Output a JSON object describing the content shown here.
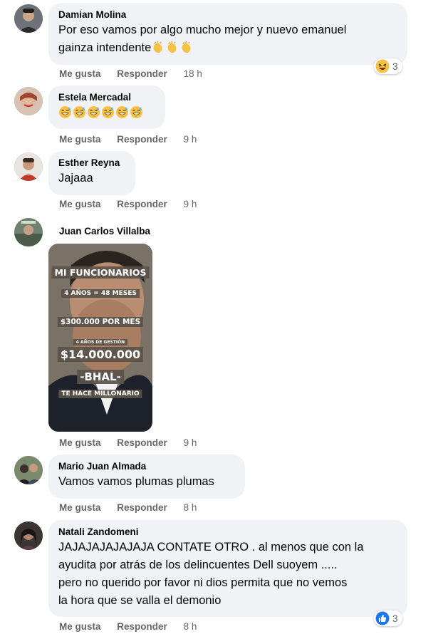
{
  "actions": {
    "like": "Me gusta",
    "reply": "Responder"
  },
  "comments": [
    {
      "author": "Damian Molina",
      "text": "Por eso vamos por algo mucho mejor y nuevo emanuel",
      "text2": "gainza intendente",
      "time": "18 h",
      "reaction": {
        "icon": "laughing-emoji-icon",
        "count": "3"
      }
    },
    {
      "author": "Estela Mercadal",
      "time": "9 h",
      "emoji_count": 6
    },
    {
      "author": "Esther Reyna",
      "text": "Jajaaa",
      "time": "9 h"
    },
    {
      "author": "Juan Carlos Villalba",
      "time": "9 h",
      "image_text": {
        "title": "MI FUNCIONARIOS",
        "line1": "4 AÑOS = 48 MESES",
        "line2": "$300.000 POR MES",
        "line3": "4 AÑOS DE GESTIÓN",
        "amount": "$14.000.000",
        "name": "-BHAL-",
        "tagline": "TE HACE MILLONARIO"
      }
    },
    {
      "author": "Mario Juan Almada",
      "text": "Vamos vamos plumas plumas",
      "time": "8 h"
    },
    {
      "author": "Natali Zandomeni",
      "lines": [
        "JAJAJAJAJAJAJA CONTATE OTRO . al menos que con la",
        "ayudita por atrás de los delincuentes Dell suoyem .....",
        "pero no querido por favor ni dios permita que no vemos",
        "la hora que se valla el demonio"
      ],
      "time": "8 h",
      "reaction": {
        "icon": "like-thumb-icon",
        "count": "3"
      }
    }
  ],
  "colors": {
    "bubble": "#f0f2f5",
    "meta": "#65676b",
    "like_blue": "#1877f2",
    "emoji_yellow": "#f7c244"
  }
}
